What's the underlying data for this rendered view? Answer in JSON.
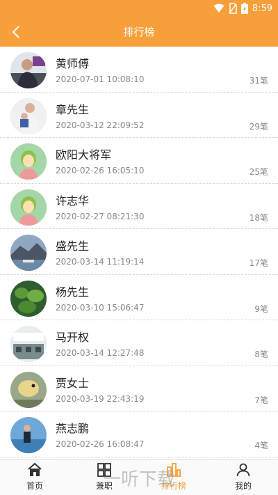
{
  "status_bar": {
    "time": "8:59"
  },
  "header": {
    "title": "排行榜",
    "back_icon": "chevron-left-icon"
  },
  "colors": {
    "accent": "#f7a03b",
    "text": "#222222",
    "subtext": "#888888"
  },
  "ranking": [
    {
      "name": "黄师傅",
      "time": "2020-07-01 10:08:10",
      "count": "31笔",
      "avatar": "photo"
    },
    {
      "name": "章先生",
      "time": "2020-03-12 22:09:52",
      "count": "29笔",
      "avatar": "photo"
    },
    {
      "name": "欧阳大将军",
      "time": "2020-02-26 16:05:10",
      "count": "25笔",
      "avatar": "default"
    },
    {
      "name": "许志华",
      "time": "2020-02-27 08:21:30",
      "count": "18笔",
      "avatar": "default"
    },
    {
      "name": "盛先生",
      "time": "2020-03-14 11:19:14",
      "count": "17笔",
      "avatar": "photo"
    },
    {
      "name": "杨先生",
      "time": "2020-03-10 15:06:47",
      "count": "9笔",
      "avatar": "photo"
    },
    {
      "name": "马开权",
      "time": "2020-03-14 12:27:48",
      "count": "8笔",
      "avatar": "photo"
    },
    {
      "name": "贾女士",
      "time": "2020-03-19 22:43:19",
      "count": "7笔",
      "avatar": "photo"
    },
    {
      "name": "燕志鹏",
      "time": "2020-02-26 16:08:47",
      "count": "4笔",
      "avatar": "photo"
    }
  ],
  "tabbar": {
    "tabs": [
      {
        "label": "首页",
        "icon": "home-icon",
        "active": false
      },
      {
        "label": "兼职",
        "icon": "grid-icon",
        "active": false
      },
      {
        "label": "排行榜",
        "icon": "ranking-icon",
        "active": true
      },
      {
        "label": "我的",
        "icon": "user-icon",
        "active": false
      }
    ],
    "watermark": "一听下载"
  }
}
